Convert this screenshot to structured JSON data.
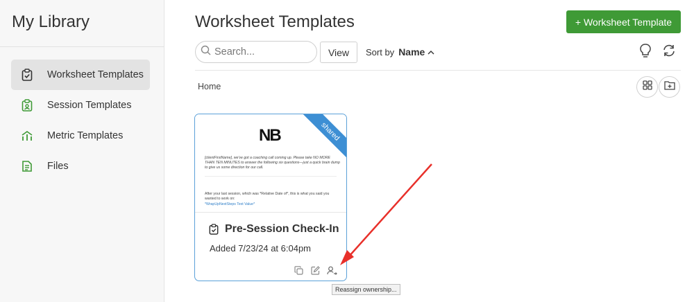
{
  "sidebar": {
    "title": "My Library",
    "items": [
      {
        "label": "Worksheet Templates",
        "icon": "clipboard-check-icon",
        "active": true
      },
      {
        "label": "Session Templates",
        "icon": "clipboard-doc-icon"
      },
      {
        "label": "Metric Templates",
        "icon": "chart-up-icon"
      },
      {
        "label": "Files",
        "icon": "file-icon"
      }
    ]
  },
  "header": {
    "title": "Worksheet Templates",
    "add_button_label": "+ Worksheet Template"
  },
  "toolbar": {
    "search_placeholder": "Search...",
    "view_label": "View",
    "sort_prefix": "Sort by",
    "sort_value": "Name"
  },
  "breadcrumb": "Home",
  "card": {
    "title": "Pre-Session Check-In",
    "added": "Added 7/23/24 at 6:04pm",
    "ribbon": "shared",
    "preview_logo": "NB",
    "preview_para1": "[clientFirstName], we've got a coaching call coming up. Please take NO MORE THAN TEN MINUTES to answer the following six questions—just a quick brain dump to give us some direction for our call.",
    "preview_para2": "After your last session, which was *Relative Date of*, this is what you said you wanted to work on:",
    "preview_link": "*WrapUpNextSteps Text Value*"
  },
  "tooltip": "Reassign ownership...",
  "colors": {
    "accent_green": "#3f9a36",
    "brand_blue": "#3d8fd4",
    "annotation_red": "#e8302a",
    "icon_green": "#3f9a36"
  }
}
